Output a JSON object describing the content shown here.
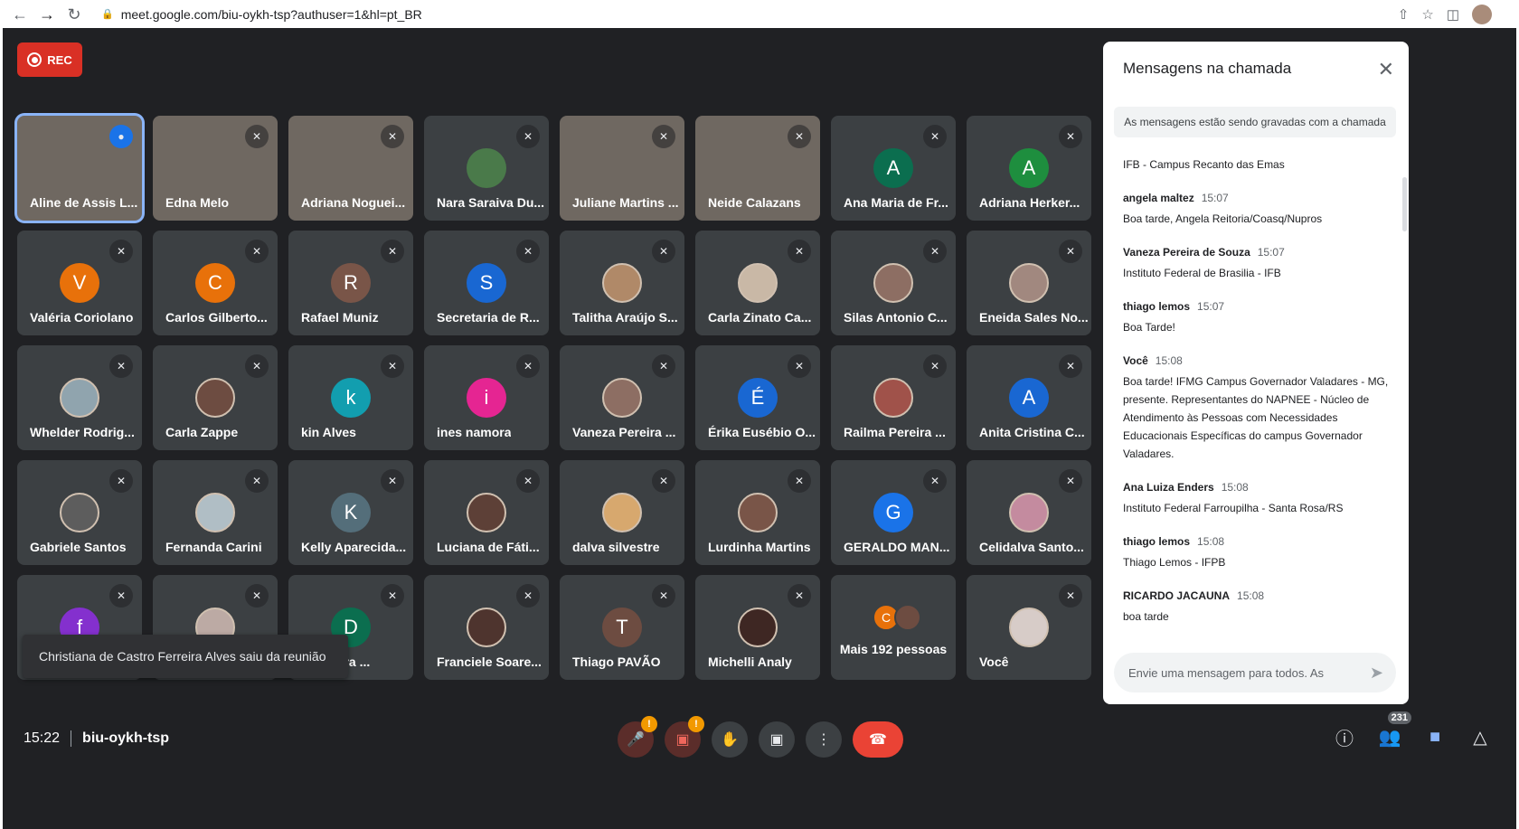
{
  "browser": {
    "url": "meet.google.com/biu-oykh-tsp?authuser=1&hl=pt_BR"
  },
  "meeting": {
    "rec_label": "REC",
    "time": "15:22",
    "code": "biu-oykh-tsp",
    "toast": "Christiana de Castro Ferreira Alves saiu da reunião",
    "participant_count": "231"
  },
  "participants": [
    {
      "name": "Aline de Assis L...",
      "type": "video",
      "speaking": true
    },
    {
      "name": "Edna Melo",
      "type": "video"
    },
    {
      "name": "Adriana Noguei...",
      "type": "video"
    },
    {
      "name": "Nara Saraiva Du...",
      "type": "avatar",
      "initial": "",
      "color": "#4a7a4a"
    },
    {
      "name": "Juliane Martins ...",
      "type": "video"
    },
    {
      "name": "Neide Calazans",
      "type": "video"
    },
    {
      "name": "Ana Maria de Fr...",
      "type": "avatar",
      "initial": "A",
      "color": "#0b6e4f"
    },
    {
      "name": "Adriana Herker...",
      "type": "avatar",
      "initial": "A",
      "color": "#1e8e3e"
    },
    {
      "name": "Valéria Coriolano",
      "type": "avatar",
      "initial": "V",
      "color": "#e8710a"
    },
    {
      "name": "Carlos Gilberto...",
      "type": "avatar",
      "initial": "C",
      "color": "#e8710a"
    },
    {
      "name": "Rafael Muniz",
      "type": "avatar",
      "initial": "R",
      "color": "#795548"
    },
    {
      "name": "Secretaria de R...",
      "type": "avatar",
      "initial": "S",
      "color": "#1967d2"
    },
    {
      "name": "Talitha Araújo S...",
      "type": "photo",
      "color": "#b08968"
    },
    {
      "name": "Carla Zinato Ca...",
      "type": "photo",
      "color": "#c9b8a6"
    },
    {
      "name": "Silas Antonio C...",
      "type": "photo",
      "color": "#8d6e63"
    },
    {
      "name": "Eneida Sales No...",
      "type": "photo",
      "color": "#a1887f"
    },
    {
      "name": "Whelder Rodrig...",
      "type": "photo",
      "color": "#90a4ae"
    },
    {
      "name": "Carla Zappe",
      "type": "photo",
      "color": "#6d4c41"
    },
    {
      "name": "kin Alves",
      "type": "avatar",
      "initial": "k",
      "color": "#129eaf"
    },
    {
      "name": "ines namora",
      "type": "avatar",
      "initial": "i",
      "color": "#e52592"
    },
    {
      "name": "Vaneza Pereira ...",
      "type": "photo",
      "color": "#8d6e63"
    },
    {
      "name": "Érika Eusébio O...",
      "type": "avatar",
      "initial": "É",
      "color": "#1967d2"
    },
    {
      "name": "Railma Pereira ...",
      "type": "photo",
      "color": "#a0524a"
    },
    {
      "name": "Anita Cristina C...",
      "type": "avatar",
      "initial": "A",
      "color": "#1967d2"
    },
    {
      "name": "Gabriele Santos",
      "type": "photo",
      "color": "#5d5d5d"
    },
    {
      "name": "Fernanda Carini",
      "type": "photo",
      "color": "#b0bec5"
    },
    {
      "name": "Kelly Aparecida...",
      "type": "avatar",
      "initial": "K",
      "color": "#546e7a"
    },
    {
      "name": "Luciana de Fáti...",
      "type": "photo",
      "color": "#5d4037"
    },
    {
      "name": "dalva silvestre",
      "type": "photo",
      "color": "#d7a86e"
    },
    {
      "name": "Lurdinha Martins",
      "type": "photo",
      "color": "#795548"
    },
    {
      "name": "GERALDO MAN...",
      "type": "avatar",
      "initial": "G",
      "color": "#1a73e8"
    },
    {
      "name": "Celidalva Santo...",
      "type": "photo",
      "color": "#c48b9f"
    },
    {
      "name": "",
      "type": "avatar",
      "initial": "f",
      "color": "#8430ce"
    },
    {
      "name": "",
      "type": "photo",
      "color": "#bcaaa4"
    },
    {
      "name": "Nogueira ...",
      "type": "avatar",
      "initial": "D",
      "color": "#0b6e4f"
    },
    {
      "name": "Franciele Soare...",
      "type": "photo",
      "color": "#4e342e"
    },
    {
      "name": "Thiago PAVÃO",
      "type": "avatar",
      "initial": "T",
      "color": "#6d4c41"
    },
    {
      "name": "Michelli Analy",
      "type": "photo",
      "color": "#3e2723"
    },
    {
      "name": "more",
      "type": "more",
      "label": "Mais 192 pessoas",
      "initial": "C"
    },
    {
      "name": "Você",
      "type": "photo",
      "color": "#d7ccc8"
    }
  ],
  "chat": {
    "title": "Mensagens na chamada",
    "notice": "As mensagens estão sendo gravadas com a chamada",
    "placeholder": "Envie uma mensagem para todos. As",
    "messages": [
      {
        "sender": "",
        "time": "",
        "text": "IFB - Campus Recanto das Emas"
      },
      {
        "sender": "angela maltez",
        "time": "15:07",
        "text": "Boa tarde, Angela Reitoria/Coasq/Nupros"
      },
      {
        "sender": "Vaneza Pereira de Souza",
        "time": "15:07",
        "text": "Instituto Federal de Brasilia - IFB"
      },
      {
        "sender": "thiago lemos",
        "time": "15:07",
        "text": "Boa Tarde!"
      },
      {
        "sender": "Você",
        "time": "15:08",
        "text": "Boa tarde! IFMG Campus Governador Valadares - MG, presente. Representantes do NAPNEE - Núcleo de Atendimento às Pessoas com Necessidades Educacionais Específicas do campus Governador Valadares."
      },
      {
        "sender": "Ana Luiza Enders",
        "time": "15:08",
        "text": "Instituto Federal Farroupilha - Santa Rosa/RS"
      },
      {
        "sender": "thiago lemos",
        "time": "15:08",
        "text": "Thiago Lemos - IFPB"
      },
      {
        "sender": "RICARDO JACAUNA",
        "time": "15:08",
        "text": "boa tarde"
      }
    ]
  },
  "icons": {
    "mute": "mic-off-icon",
    "speaking": "speaking-icon",
    "hangup": "call-end-icon"
  }
}
